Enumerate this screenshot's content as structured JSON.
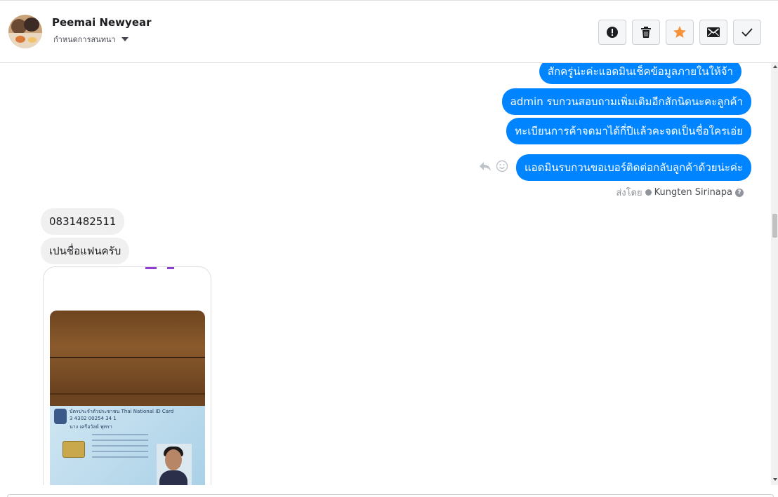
{
  "header": {
    "contact_name": "Peemai Newyear",
    "subtitle": "กำหนดการสนทนา",
    "toolbar": [
      {
        "name": "spam-button",
        "icon": "exclamation-circle-icon"
      },
      {
        "name": "delete-button",
        "icon": "trash-icon"
      },
      {
        "name": "star-button",
        "icon": "star-icon",
        "color": "#f7923b"
      },
      {
        "name": "mark-unread-button",
        "icon": "envelope-icon"
      },
      {
        "name": "mark-done-button",
        "icon": "checkmark-icon"
      }
    ]
  },
  "messages": {
    "outgoing": [
      "สักครู่น่ะค่ะแอดมินเช็คข้อมูลภายในให้จ้า",
      "admin รบกวนสอบถามเพิ่มเติมอีกสักนิดนะคะลูกค้า",
      "ทะเบียนการค้าจดมาได้กี่ปีแล้วคะจดเป็นชื่อใครเอ่ย",
      "แอดมินรบกวนขอเบอร์ติดต่อกลับลูกค้าด้วยน่ะค่ะ"
    ],
    "sent_by_prefix": "ส่งโดย",
    "sent_by_name": "Kungten Sirinapa",
    "incoming": [
      "0831482511",
      "เปนชื่อแฟนครับ"
    ],
    "attachment": {
      "card_title": "บัตรประจำตัวประชาชน Thai National ID Card",
      "card_number": "3 4302 00254 34 1",
      "card_name": "นาง เครือวัลย์ พุทรา"
    }
  },
  "colors": {
    "outgoing_bubble": "#0084ff",
    "incoming_bubble": "#f1f0f0",
    "star": "#f7923b"
  }
}
